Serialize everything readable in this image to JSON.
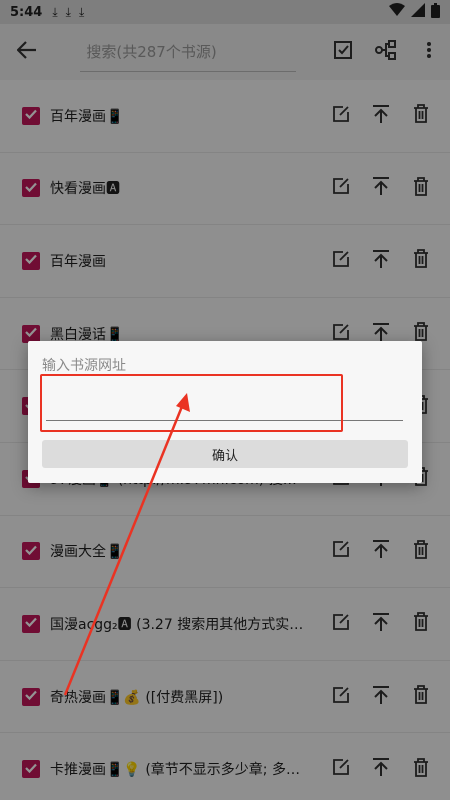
{
  "status": {
    "time": "5:44",
    "downloads": [
      "⤓",
      "⤓",
      "⤓"
    ]
  },
  "toolbar": {
    "search_placeholder": "搜索(共287个书源)"
  },
  "sources": [
    {
      "name": "百年漫画📱",
      "checked": true
    },
    {
      "name": "快看漫画🅰",
      "checked": true
    },
    {
      "name": "百年漫画",
      "checked": true
    },
    {
      "name": "黑白漫话📱",
      "checked": true
    },
    {
      "name": "",
      "checked": true
    },
    {
      "name": "97漫画📱 (http://m.97mh.com) 搜索出",
      "checked": true
    },
    {
      "name": "漫画大全📱",
      "checked": true
    },
    {
      "name": "国漫acgg₂🅰 (3.27 搜索用其他方式实现…",
      "checked": true
    },
    {
      "name": "奇热漫画📱💰 ([付费黑屏])",
      "checked": true
    },
    {
      "name": "卡推漫画📱💡 (章节不显示多少章; 多少…",
      "checked": true
    }
  ],
  "dialog": {
    "title": "输入书源网址",
    "input_value": "",
    "confirm_label": "确认"
  },
  "colors": {
    "accent": "#c2185b",
    "annotation": "#ea3323"
  }
}
